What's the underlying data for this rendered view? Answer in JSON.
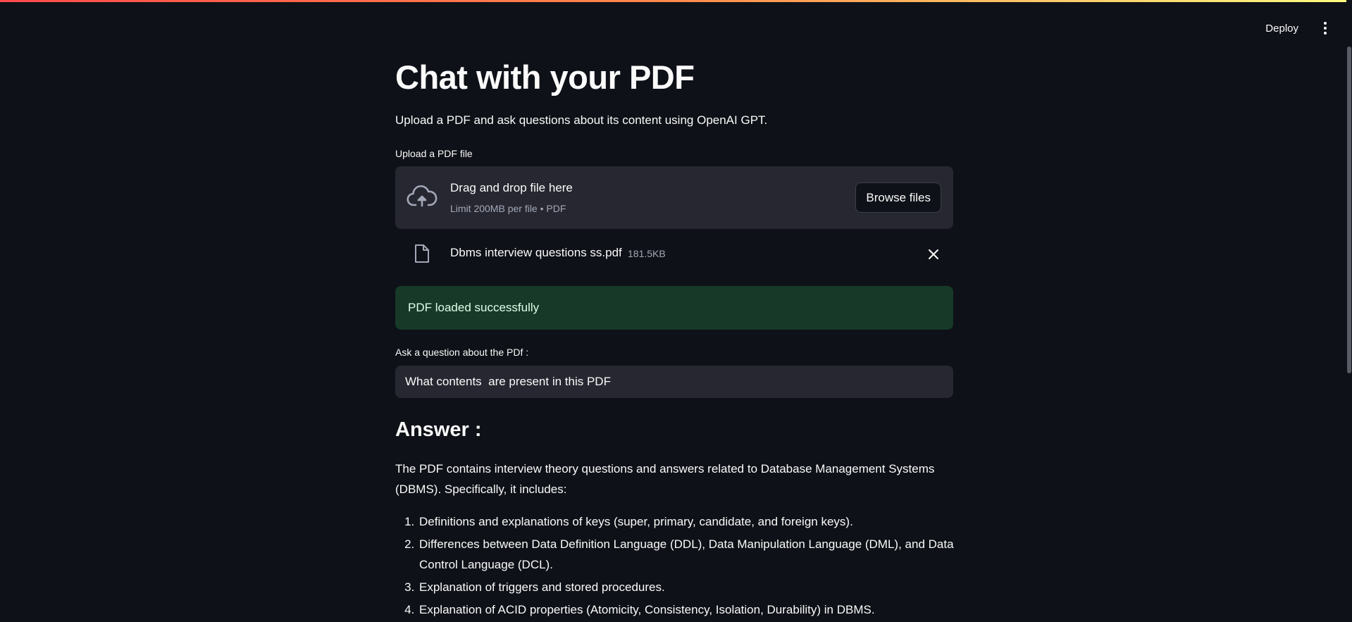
{
  "toolbar": {
    "deploy_label": "Deploy",
    "menu_icon": "vertical-ellipsis-icon"
  },
  "page": {
    "title": "Chat with your PDF",
    "subtitle": "Upload a PDF and ask questions about its content using OpenAI GPT."
  },
  "uploader": {
    "label": "Upload a PDF file",
    "dropzone_title": "Drag and drop file here",
    "dropzone_limit": "Limit 200MB per file • PDF",
    "browse_label": "Browse files",
    "upload_icon": "cloud-upload-icon",
    "file": {
      "name": "Dbms interview questions ss.pdf",
      "size": "181.5KB",
      "icon": "document-icon",
      "remove_icon": "close-icon"
    }
  },
  "status": {
    "message": "PDF loaded successfully",
    "color": "#173928"
  },
  "question": {
    "label": "Ask a question about the PDf :",
    "value": "What contents  are present in this PDF"
  },
  "answer": {
    "heading": "Answer :",
    "intro": "The PDF contains interview theory questions and answers related to Database Management Systems (DBMS). Specifically, it includes:",
    "items": [
      "Definitions and explanations of keys (super, primary, candidate, and foreign keys).",
      "Differences between Data Definition Language (DDL), Data Manipulation Language (DML), and Data Control Language (DCL).",
      "Explanation of triggers and stored procedures.",
      "Explanation of ACID properties (Atomicity, Consistency, Isolation, Durability) in DBMS."
    ]
  },
  "colors": {
    "background": "#0e1117",
    "surface": "#262730",
    "accent": "#ff4b4b"
  }
}
